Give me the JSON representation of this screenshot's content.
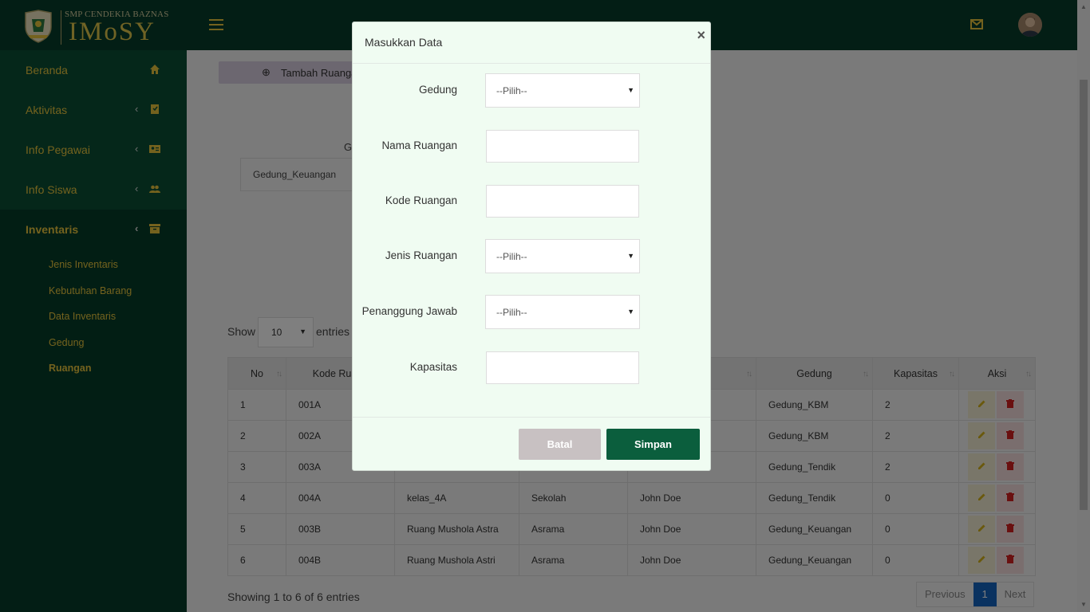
{
  "brand": {
    "school": "SMP CENDEKIA BAZNAS",
    "app": "IMoSY"
  },
  "sidebar": {
    "items": [
      {
        "label": "Beranda",
        "icon": "home-icon"
      },
      {
        "label": "Aktivitas",
        "icon": "bookmark-box-icon"
      },
      {
        "label": "Info Pegawai",
        "icon": "id-card-icon"
      },
      {
        "label": "Info Siswa",
        "icon": "people-icon"
      },
      {
        "label": "Inventaris",
        "icon": "archive-box-icon"
      }
    ],
    "sub_items": [
      "Jenis Inventaris",
      "Kebutuhan Barang",
      "Data Inventaris",
      "Gedung",
      "Ruangan"
    ]
  },
  "content": {
    "add_button": "Tambah Ruangan",
    "filter_label": "G",
    "filter_value": "Gedung_Keuangan",
    "show_label": "Show",
    "show_value": "10",
    "entries_label": "entries",
    "columns": [
      "No",
      "Kode Ruang",
      "",
      "",
      "wab",
      "Gedung",
      "Kapasitas",
      "Aksi"
    ],
    "rows": [
      [
        "1",
        "001A",
        "",
        "",
        "",
        "Gedung_KBM",
        "2"
      ],
      [
        "2",
        "002A",
        "",
        "",
        "",
        "Gedung_KBM",
        "2"
      ],
      [
        "3",
        "003A",
        "",
        "",
        "",
        "Gedung_Tendik",
        "2"
      ],
      [
        "4",
        "004A",
        "kelas_4A",
        "Sekolah",
        "John Doe",
        "Gedung_Tendik",
        "0"
      ],
      [
        "5",
        "003B",
        "Ruang Mushola Astra",
        "Asrama",
        "John Doe",
        "Gedung_Keuangan",
        "0"
      ],
      [
        "6",
        "004B",
        "Ruang Mushola Astri",
        "Asrama",
        "John Doe",
        "Gedung_Keuangan",
        "0"
      ]
    ],
    "showing": "Showing 1 to 6 of 6 entries",
    "pager": {
      "previous": "Previous",
      "page": "1",
      "next": "Next"
    }
  },
  "modal": {
    "title": "Masukkan Data",
    "close": "×",
    "fields": [
      {
        "label": "Gedung",
        "type": "select",
        "value": "--Pilih--"
      },
      {
        "label": "Nama Ruangan",
        "type": "input",
        "value": ""
      },
      {
        "label": "Kode Ruangan",
        "type": "input",
        "value": ""
      },
      {
        "label": "Jenis Ruangan",
        "type": "select",
        "value": "--Pilih--"
      },
      {
        "label": "Penanggung Jawab",
        "type": "select",
        "value": "--Pilih--"
      },
      {
        "label": "Kapasitas",
        "type": "input",
        "value": ""
      }
    ],
    "cancel": "Batal",
    "save": "Simpan"
  },
  "colors": {
    "primary": "#063d2a",
    "accent": "#e8c53d",
    "save": "#0b5e3d",
    "modal_bg": "#f0fcf2"
  }
}
